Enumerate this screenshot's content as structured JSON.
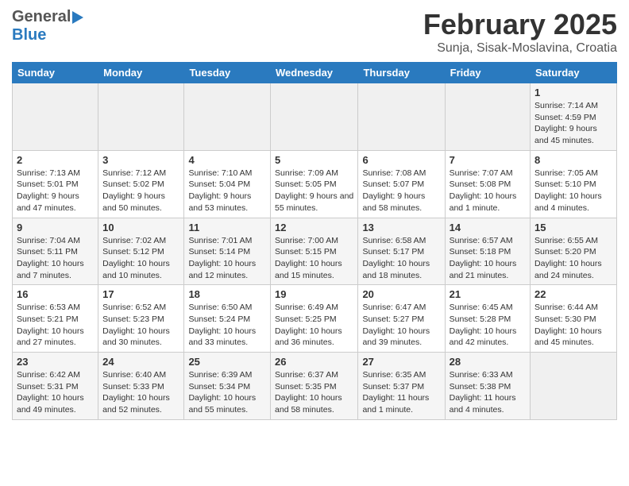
{
  "header": {
    "logo_general": "General",
    "logo_blue": "Blue",
    "title": "February 2025",
    "location": "Sunja, Sisak-Moslavina, Croatia"
  },
  "weekdays": [
    "Sunday",
    "Monday",
    "Tuesday",
    "Wednesday",
    "Thursday",
    "Friday",
    "Saturday"
  ],
  "weeks": [
    [
      {
        "day": "",
        "info": ""
      },
      {
        "day": "",
        "info": ""
      },
      {
        "day": "",
        "info": ""
      },
      {
        "day": "",
        "info": ""
      },
      {
        "day": "",
        "info": ""
      },
      {
        "day": "",
        "info": ""
      },
      {
        "day": "1",
        "info": "Sunrise: 7:14 AM\nSunset: 4:59 PM\nDaylight: 9 hours and 45 minutes."
      }
    ],
    [
      {
        "day": "2",
        "info": "Sunrise: 7:13 AM\nSunset: 5:01 PM\nDaylight: 9 hours and 47 minutes."
      },
      {
        "day": "3",
        "info": "Sunrise: 7:12 AM\nSunset: 5:02 PM\nDaylight: 9 hours and 50 minutes."
      },
      {
        "day": "4",
        "info": "Sunrise: 7:10 AM\nSunset: 5:04 PM\nDaylight: 9 hours and 53 minutes."
      },
      {
        "day": "5",
        "info": "Sunrise: 7:09 AM\nSunset: 5:05 PM\nDaylight: 9 hours and 55 minutes."
      },
      {
        "day": "6",
        "info": "Sunrise: 7:08 AM\nSunset: 5:07 PM\nDaylight: 9 hours and 58 minutes."
      },
      {
        "day": "7",
        "info": "Sunrise: 7:07 AM\nSunset: 5:08 PM\nDaylight: 10 hours and 1 minute."
      },
      {
        "day": "8",
        "info": "Sunrise: 7:05 AM\nSunset: 5:10 PM\nDaylight: 10 hours and 4 minutes."
      }
    ],
    [
      {
        "day": "9",
        "info": "Sunrise: 7:04 AM\nSunset: 5:11 PM\nDaylight: 10 hours and 7 minutes."
      },
      {
        "day": "10",
        "info": "Sunrise: 7:02 AM\nSunset: 5:12 PM\nDaylight: 10 hours and 10 minutes."
      },
      {
        "day": "11",
        "info": "Sunrise: 7:01 AM\nSunset: 5:14 PM\nDaylight: 10 hours and 12 minutes."
      },
      {
        "day": "12",
        "info": "Sunrise: 7:00 AM\nSunset: 5:15 PM\nDaylight: 10 hours and 15 minutes."
      },
      {
        "day": "13",
        "info": "Sunrise: 6:58 AM\nSunset: 5:17 PM\nDaylight: 10 hours and 18 minutes."
      },
      {
        "day": "14",
        "info": "Sunrise: 6:57 AM\nSunset: 5:18 PM\nDaylight: 10 hours and 21 minutes."
      },
      {
        "day": "15",
        "info": "Sunrise: 6:55 AM\nSunset: 5:20 PM\nDaylight: 10 hours and 24 minutes."
      }
    ],
    [
      {
        "day": "16",
        "info": "Sunrise: 6:53 AM\nSunset: 5:21 PM\nDaylight: 10 hours and 27 minutes."
      },
      {
        "day": "17",
        "info": "Sunrise: 6:52 AM\nSunset: 5:23 PM\nDaylight: 10 hours and 30 minutes."
      },
      {
        "day": "18",
        "info": "Sunrise: 6:50 AM\nSunset: 5:24 PM\nDaylight: 10 hours and 33 minutes."
      },
      {
        "day": "19",
        "info": "Sunrise: 6:49 AM\nSunset: 5:25 PM\nDaylight: 10 hours and 36 minutes."
      },
      {
        "day": "20",
        "info": "Sunrise: 6:47 AM\nSunset: 5:27 PM\nDaylight: 10 hours and 39 minutes."
      },
      {
        "day": "21",
        "info": "Sunrise: 6:45 AM\nSunset: 5:28 PM\nDaylight: 10 hours and 42 minutes."
      },
      {
        "day": "22",
        "info": "Sunrise: 6:44 AM\nSunset: 5:30 PM\nDaylight: 10 hours and 45 minutes."
      }
    ],
    [
      {
        "day": "23",
        "info": "Sunrise: 6:42 AM\nSunset: 5:31 PM\nDaylight: 10 hours and 49 minutes."
      },
      {
        "day": "24",
        "info": "Sunrise: 6:40 AM\nSunset: 5:33 PM\nDaylight: 10 hours and 52 minutes."
      },
      {
        "day": "25",
        "info": "Sunrise: 6:39 AM\nSunset: 5:34 PM\nDaylight: 10 hours and 55 minutes."
      },
      {
        "day": "26",
        "info": "Sunrise: 6:37 AM\nSunset: 5:35 PM\nDaylight: 10 hours and 58 minutes."
      },
      {
        "day": "27",
        "info": "Sunrise: 6:35 AM\nSunset: 5:37 PM\nDaylight: 11 hours and 1 minute."
      },
      {
        "day": "28",
        "info": "Sunrise: 6:33 AM\nSunset: 5:38 PM\nDaylight: 11 hours and 4 minutes."
      },
      {
        "day": "",
        "info": ""
      }
    ]
  ]
}
